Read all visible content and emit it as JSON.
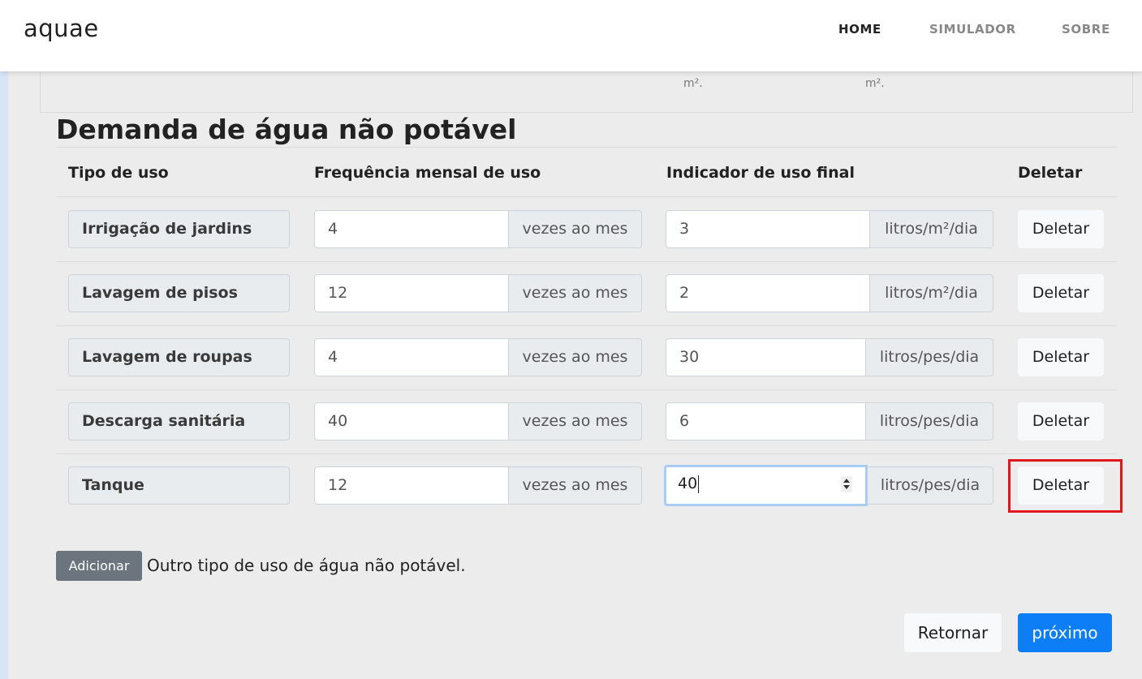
{
  "navbar": {
    "brand": "aquae",
    "items": [
      {
        "label": "HOME",
        "active": true
      },
      {
        "label": "SIMULADOR",
        "active": false
      },
      {
        "label": "SOBRE",
        "active": false
      }
    ]
  },
  "previous_section": {
    "unit_notes": [
      "m².",
      "m²."
    ]
  },
  "section": {
    "title": "Demanda de água não potável",
    "headers": [
      "Tipo de uso",
      "Frequência mensal de uso",
      "Indicador de uso final",
      "Deletar"
    ],
    "rows": [
      {
        "name": "Irrigação de jardins",
        "frequency": "4",
        "frequency_unit": "vezes ao mes",
        "indicator": "3",
        "indicator_unit": "litros/m²/dia",
        "delete_label": "Deletar"
      },
      {
        "name": "Lavagem de pisos",
        "frequency": "12",
        "frequency_unit": "vezes ao mes",
        "indicator": "2",
        "indicator_unit": "litros/m²/dia",
        "delete_label": "Deletar"
      },
      {
        "name": "Lavagem de roupas",
        "frequency": "4",
        "frequency_unit": "vezes ao mes",
        "indicator": "30",
        "indicator_unit": "litros/pes/dia",
        "delete_label": "Deletar"
      },
      {
        "name": "Descarga sanitária",
        "frequency": "40",
        "frequency_unit": "vezes ao mes",
        "indicator": "6",
        "indicator_unit": "litros/pes/dia",
        "delete_label": "Deletar"
      },
      {
        "name": "Tanque",
        "frequency": "12",
        "frequency_unit": "vezes ao mes",
        "indicator": "40",
        "indicator_unit": "litros/pes/dia",
        "delete_label": "Deletar"
      }
    ],
    "add_button": "Adicionar",
    "add_text": "Outro tipo de uso de água não potável."
  },
  "footer": {
    "back_label": "Retornar",
    "next_label": "próximo"
  },
  "colors": {
    "primary": "#0d7ef5",
    "secondary": "#6c757d",
    "highlight": "#e0161f",
    "focus_ring": "#a9cdf2"
  }
}
